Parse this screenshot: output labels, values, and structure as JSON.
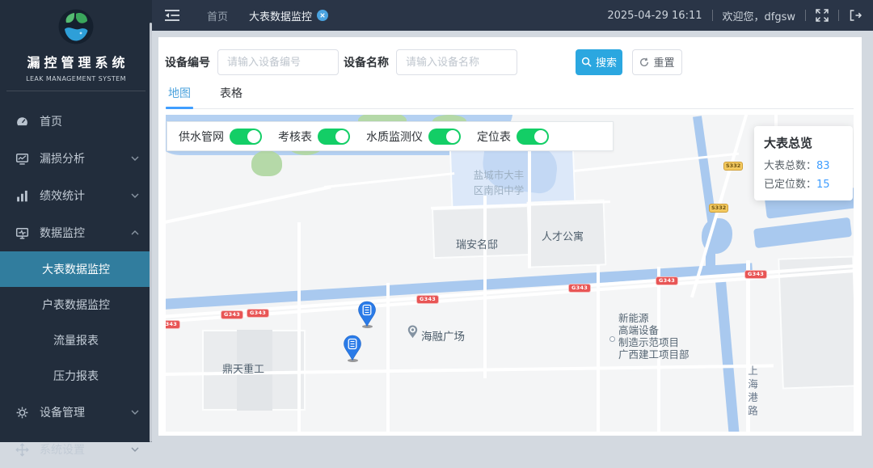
{
  "brand": {
    "title": "漏控管理系统",
    "subtitle": "LEAK MANAGEMENT SYSTEM"
  },
  "sidebar": {
    "menu": [
      {
        "label": "首页"
      },
      {
        "label": "漏损分析"
      },
      {
        "label": "绩效统计"
      },
      {
        "label": "数据监控"
      },
      {
        "label": "设备管理"
      },
      {
        "label": "系统设置"
      }
    ],
    "submenu": [
      "大表数据监控",
      "户表数据监控",
      "流量报表",
      "压力报表"
    ],
    "active_submenu": "大表数据监控"
  },
  "topbar": {
    "home_tag": "首页",
    "active_tag": "大表数据监控",
    "datetime": "2025-04-29 16:11",
    "welcome": "欢迎您，dfgsw"
  },
  "filters": {
    "device_no_label": "设备编号",
    "device_no_placeholder": "请输入设备编号",
    "device_name_label": "设备名称",
    "device_name_placeholder": "请输入设备名称",
    "search_label": "搜索",
    "reset_label": "重置"
  },
  "view_tabs": {
    "map": "地图",
    "table": "表格"
  },
  "map": {
    "toggles": [
      {
        "label": "供水管网",
        "on": true
      },
      {
        "label": "考核表",
        "on": true
      },
      {
        "label": "水质监测仪",
        "on": true
      },
      {
        "label": "定位表",
        "on": true
      }
    ],
    "overview": {
      "title": "大表总览",
      "rows": [
        {
          "label": "大表总数：",
          "value": "83"
        },
        {
          "label": "已定位数：",
          "value": "15"
        }
      ]
    },
    "labels": {
      "school_line1": "盐城市大丰",
      "school_line2": "区南阳中学",
      "ruian": "瑞安名邸",
      "rencai": "人才公寓",
      "dingtian": "鼎天重工",
      "hairong": "海融广场",
      "project_lines": [
        "新能源",
        "高端设备",
        "制造示范项目",
        "广西建工项目部"
      ],
      "shanghai_road": "上海港路"
    },
    "badges": {
      "g343": "G343",
      "s332": "S332"
    }
  },
  "colors": {
    "accent": "#409eff",
    "search_button": "#2ba7e0",
    "toggle_on": "#13ce66",
    "active_menu_bg": "#317d9e",
    "badge_red": "#e85555",
    "badge_yellow": "#f3c95f",
    "sidebar_bg": "#222d3c",
    "topbar_bg": "#2a3547"
  }
}
